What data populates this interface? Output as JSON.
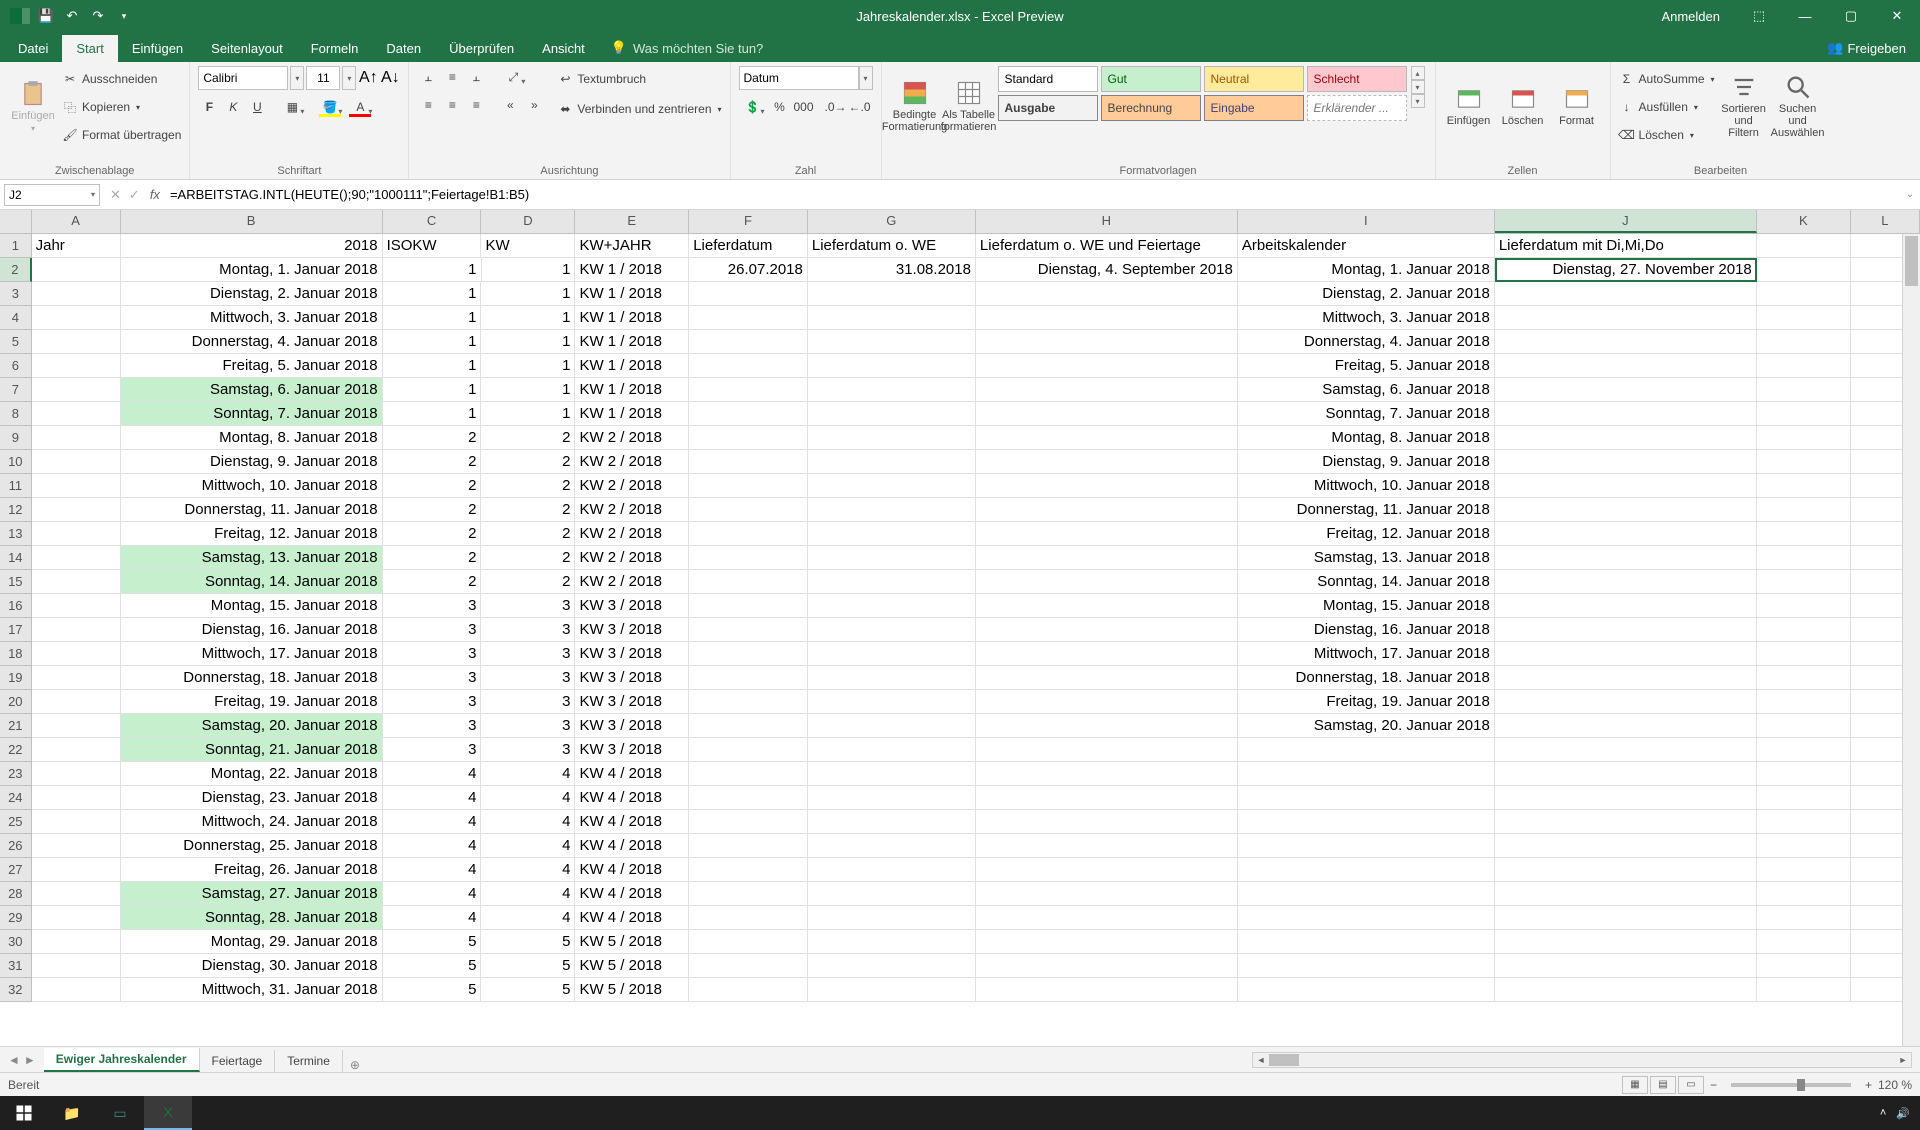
{
  "title": "Jahreskalender.xlsx - Excel Preview",
  "qat": {
    "save": "💾",
    "undo": "↶",
    "redo": "↷"
  },
  "windowButtons": {
    "login": "Anmelden",
    "min": "—",
    "max": "▢",
    "close": "✕"
  },
  "tabs": {
    "file": "Datei",
    "start": "Start",
    "einfuegen": "Einfügen",
    "seitenlayout": "Seitenlayout",
    "formeln": "Formeln",
    "daten": "Daten",
    "ueberpruefen": "Überprüfen",
    "ansicht": "Ansicht",
    "tellme": "Was möchten Sie tun?",
    "share": "Freigeben"
  },
  "clipboard": {
    "label": "Zwischenablage",
    "paste": "Einfügen",
    "cut": "Ausschneiden",
    "copy": "Kopieren",
    "format_painter": "Format übertragen"
  },
  "font": {
    "label": "Schriftart",
    "name": "Calibri",
    "size": "11"
  },
  "alignment": {
    "label": "Ausrichtung",
    "wrap": "Textumbruch",
    "merge": "Verbinden und zentrieren"
  },
  "number": {
    "label": "Zahl",
    "format": "Datum"
  },
  "tables": {
    "cond": "Bedingte\nFormatierung",
    "astable": "Als Tabelle\nformatieren"
  },
  "styles": {
    "label": "Formatvorlagen",
    "standard": "Standard",
    "gut": "Gut",
    "neutral": "Neutral",
    "schlecht": "Schlecht",
    "ausgabe": "Ausgabe",
    "berechnung": "Berechnung",
    "eingabe": "Eingabe",
    "erklaerend": "Erklärender ..."
  },
  "cells": {
    "label": "Zellen",
    "insert": "Einfügen",
    "delete": "Löschen",
    "format": "Format"
  },
  "editing": {
    "label": "Bearbeiten",
    "autosum": "AutoSumme",
    "fill": "Ausfüllen",
    "clear": "Löschen",
    "sort": "Sortieren und\nFiltern",
    "find": "Suchen und\nAuswählen"
  },
  "nameBox": "J2",
  "formula": "=ARBEITSTAG.INTL(HEUTE();90;\"1000111\";Feiertage!B1:B5)",
  "columns": [
    "A",
    "B",
    "C",
    "D",
    "E",
    "F",
    "G",
    "H",
    "I",
    "J",
    "K",
    "L"
  ],
  "headers": {
    "A": "Jahr",
    "B": "2018",
    "B_label": "",
    "C": "ISOKW",
    "D": "KW",
    "E": "KW+JAHR",
    "F": "Lieferdatum",
    "G": "Lieferdatum o. WE",
    "H": "Lieferdatum o. WE und Feiertage",
    "I": "Arbeitskalender",
    "J": "Lieferdatum mit Di,Mi,Do"
  },
  "activeCell": "J2",
  "j2Value": "Dienstag, 27. November 2018",
  "f2": "26.07.2018",
  "g2": "31.08.2018",
  "h2": "Dienstag, 4. September 2018",
  "rows": [
    {
      "n": 2,
      "b": "Montag, 1. Januar 2018",
      "c": "1",
      "d": "1",
      "e": "KW 1 / 2018",
      "i": "Montag, 1. Januar 2018",
      "we": false
    },
    {
      "n": 3,
      "b": "Dienstag, 2. Januar 2018",
      "c": "1",
      "d": "1",
      "e": "KW 1 / 2018",
      "i": "Dienstag, 2. Januar 2018",
      "we": false
    },
    {
      "n": 4,
      "b": "Mittwoch, 3. Januar 2018",
      "c": "1",
      "d": "1",
      "e": "KW 1 / 2018",
      "i": "Mittwoch, 3. Januar 2018",
      "we": false
    },
    {
      "n": 5,
      "b": "Donnerstag, 4. Januar 2018",
      "c": "1",
      "d": "1",
      "e": "KW 1 / 2018",
      "i": "Donnerstag, 4. Januar 2018",
      "we": false
    },
    {
      "n": 6,
      "b": "Freitag, 5. Januar 2018",
      "c": "1",
      "d": "1",
      "e": "KW 1 / 2018",
      "i": "Freitag, 5. Januar 2018",
      "we": false
    },
    {
      "n": 7,
      "b": "Samstag, 6. Januar 2018",
      "c": "1",
      "d": "1",
      "e": "KW 1 / 2018",
      "i": "Samstag, 6. Januar 2018",
      "we": true
    },
    {
      "n": 8,
      "b": "Sonntag, 7. Januar 2018",
      "c": "1",
      "d": "1",
      "e": "KW 1 / 2018",
      "i": "Sonntag, 7. Januar 2018",
      "we": true
    },
    {
      "n": 9,
      "b": "Montag, 8. Januar 2018",
      "c": "2",
      "d": "2",
      "e": "KW 2 / 2018",
      "i": "Montag, 8. Januar 2018",
      "we": false
    },
    {
      "n": 10,
      "b": "Dienstag, 9. Januar 2018",
      "c": "2",
      "d": "2",
      "e": "KW 2 / 2018",
      "i": "Dienstag, 9. Januar 2018",
      "we": false
    },
    {
      "n": 11,
      "b": "Mittwoch, 10. Januar 2018",
      "c": "2",
      "d": "2",
      "e": "KW 2 / 2018",
      "i": "Mittwoch, 10. Januar 2018",
      "we": false
    },
    {
      "n": 12,
      "b": "Donnerstag, 11. Januar 2018",
      "c": "2",
      "d": "2",
      "e": "KW 2 / 2018",
      "i": "Donnerstag, 11. Januar 2018",
      "we": false
    },
    {
      "n": 13,
      "b": "Freitag, 12. Januar 2018",
      "c": "2",
      "d": "2",
      "e": "KW 2 / 2018",
      "i": "Freitag, 12. Januar 2018",
      "we": false
    },
    {
      "n": 14,
      "b": "Samstag, 13. Januar 2018",
      "c": "2",
      "d": "2",
      "e": "KW 2 / 2018",
      "i": "Samstag, 13. Januar 2018",
      "we": true
    },
    {
      "n": 15,
      "b": "Sonntag, 14. Januar 2018",
      "c": "2",
      "d": "2",
      "e": "KW 2 / 2018",
      "i": "Sonntag, 14. Januar 2018",
      "we": true
    },
    {
      "n": 16,
      "b": "Montag, 15. Januar 2018",
      "c": "3",
      "d": "3",
      "e": "KW 3 / 2018",
      "i": "Montag, 15. Januar 2018",
      "we": false
    },
    {
      "n": 17,
      "b": "Dienstag, 16. Januar 2018",
      "c": "3",
      "d": "3",
      "e": "KW 3 / 2018",
      "i": "Dienstag, 16. Januar 2018",
      "we": false
    },
    {
      "n": 18,
      "b": "Mittwoch, 17. Januar 2018",
      "c": "3",
      "d": "3",
      "e": "KW 3 / 2018",
      "i": "Mittwoch, 17. Januar 2018",
      "we": false
    },
    {
      "n": 19,
      "b": "Donnerstag, 18. Januar 2018",
      "c": "3",
      "d": "3",
      "e": "KW 3 / 2018",
      "i": "Donnerstag, 18. Januar 2018",
      "we": false
    },
    {
      "n": 20,
      "b": "Freitag, 19. Januar 2018",
      "c": "3",
      "d": "3",
      "e": "KW 3 / 2018",
      "i": "Freitag, 19. Januar 2018",
      "we": false
    },
    {
      "n": 21,
      "b": "Samstag, 20. Januar 2018",
      "c": "3",
      "d": "3",
      "e": "KW 3 / 2018",
      "i": "Samstag, 20. Januar 2018",
      "we": true
    },
    {
      "n": 22,
      "b": "Sonntag, 21. Januar 2018",
      "c": "3",
      "d": "3",
      "e": "KW 3 / 2018",
      "i": "",
      "we": true
    },
    {
      "n": 23,
      "b": "Montag, 22. Januar 2018",
      "c": "4",
      "d": "4",
      "e": "KW 4 / 2018",
      "i": "",
      "we": false
    },
    {
      "n": 24,
      "b": "Dienstag, 23. Januar 2018",
      "c": "4",
      "d": "4",
      "e": "KW 4 / 2018",
      "i": "",
      "we": false
    },
    {
      "n": 25,
      "b": "Mittwoch, 24. Januar 2018",
      "c": "4",
      "d": "4",
      "e": "KW 4 / 2018",
      "i": "",
      "we": false
    },
    {
      "n": 26,
      "b": "Donnerstag, 25. Januar 2018",
      "c": "4",
      "d": "4",
      "e": "KW 4 / 2018",
      "i": "",
      "we": false
    },
    {
      "n": 27,
      "b": "Freitag, 26. Januar 2018",
      "c": "4",
      "d": "4",
      "e": "KW 4 / 2018",
      "i": "",
      "we": false
    },
    {
      "n": 28,
      "b": "Samstag, 27. Januar 2018",
      "c": "4",
      "d": "4",
      "e": "KW 4 / 2018",
      "i": "",
      "we": true
    },
    {
      "n": 29,
      "b": "Sonntag, 28. Januar 2018",
      "c": "4",
      "d": "4",
      "e": "KW 4 / 2018",
      "i": "",
      "we": true
    },
    {
      "n": 30,
      "b": "Montag, 29. Januar 2018",
      "c": "5",
      "d": "5",
      "e": "KW 5 / 2018",
      "i": "",
      "we": false
    },
    {
      "n": 31,
      "b": "Dienstag, 30. Januar 2018",
      "c": "5",
      "d": "5",
      "e": "KW 5 / 2018",
      "i": "",
      "we": false
    },
    {
      "n": 32,
      "b": "Mittwoch, 31. Januar 2018",
      "c": "5",
      "d": "5",
      "e": "KW 5 / 2018",
      "i": "",
      "we": false
    }
  ],
  "sheets": {
    "nav_prev": "◄",
    "nav_next": "►",
    "s1": "Ewiger Jahreskalender",
    "s2": "Feiertage",
    "s3": "Termine",
    "add": "⊕"
  },
  "status": {
    "ready": "Bereit",
    "zoom": "120 %"
  }
}
